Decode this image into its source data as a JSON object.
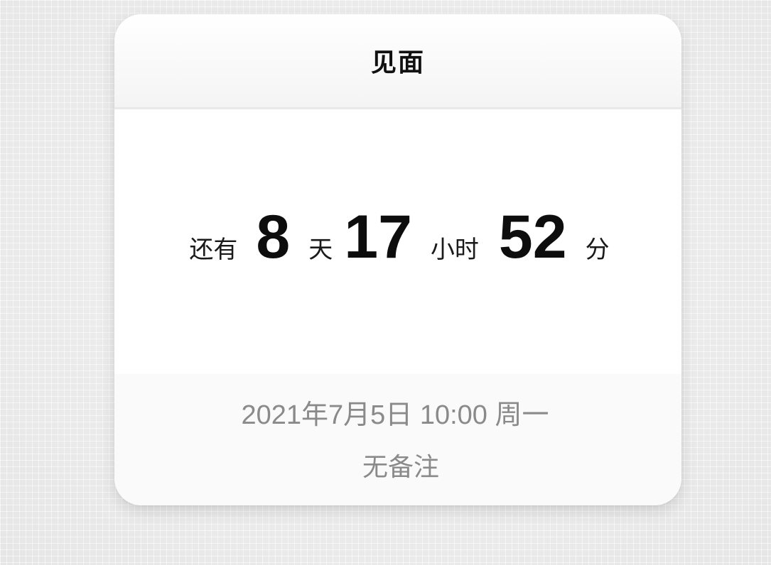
{
  "event": {
    "title": "见面"
  },
  "countdown": {
    "prefix": "还有",
    "days": "8",
    "days_unit": "天",
    "hours": "17",
    "hours_unit": "小时",
    "minutes": "52",
    "minutes_unit": "分"
  },
  "details": {
    "datetime": "2021年7月5日 10:00 周一",
    "note": "无备注"
  },
  "colors": {
    "background": "#ececec",
    "card": "#ffffff",
    "footer": "#fafafa",
    "primary_text": "#111111",
    "secondary_text": "#8a8a8a"
  }
}
